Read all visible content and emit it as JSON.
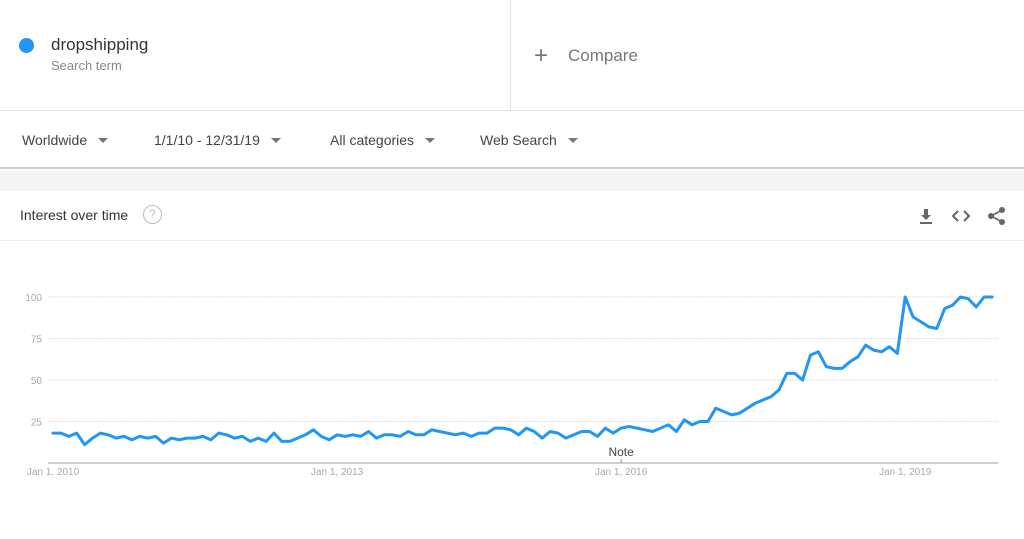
{
  "search_term": {
    "name": "dropshipping",
    "subtitle": "Search term",
    "color": "#2196f3"
  },
  "compare": {
    "icon": "plus-icon",
    "label": "Compare"
  },
  "filters": [
    {
      "label": "Worldwide"
    },
    {
      "label": "1/1/10 - 12/31/19"
    },
    {
      "label": "All categories"
    },
    {
      "label": "Web Search"
    }
  ],
  "card": {
    "title": "Interest over time",
    "help_icon": "?",
    "tools": [
      "download-icon",
      "embed-icon",
      "share-icon"
    ]
  },
  "chart_data": {
    "type": "line",
    "title": "Interest over time",
    "xlabel": "",
    "ylabel": "",
    "ylim": [
      0,
      100
    ],
    "y_ticks": [
      25,
      50,
      75,
      100
    ],
    "x_tick_labels": [
      "Jan 1, 2010",
      "Jan 1, 2013",
      "Jan 1, 2016",
      "Jan 1, 2019"
    ],
    "x_tick_indices": [
      0,
      36,
      72,
      108
    ],
    "grid": true,
    "legend": "none",
    "annotations": [
      {
        "label": "Note",
        "index": 72
      }
    ],
    "series": [
      {
        "name": "dropshipping",
        "color": "#2196f3",
        "x_start": "2010-01",
        "x_step": "month",
        "values": [
          18,
          18,
          16,
          18,
          11,
          15,
          18,
          17,
          15,
          16,
          14,
          16,
          15,
          16,
          12,
          15,
          14,
          15,
          15,
          16,
          14,
          18,
          17,
          15,
          16,
          13,
          15,
          13,
          18,
          13,
          13,
          15,
          17,
          20,
          16,
          14,
          17,
          16,
          17,
          16,
          19,
          15,
          17,
          17,
          16,
          19,
          17,
          17,
          20,
          19,
          18,
          17,
          18,
          16,
          18,
          18,
          21,
          21,
          20,
          17,
          21,
          19,
          15,
          19,
          18,
          15,
          17,
          19,
          19,
          16,
          21,
          18,
          21,
          22,
          21,
          20,
          19,
          21,
          23,
          19,
          26,
          23,
          25,
          25,
          33,
          31,
          29,
          30,
          33,
          36,
          38,
          40,
          44,
          54,
          54,
          50,
          65,
          67,
          58,
          57,
          57,
          61,
          64,
          71,
          68,
          67,
          70,
          66,
          100,
          88,
          85,
          82,
          81,
          93,
          95,
          100,
          99,
          94,
          100,
          100
        ]
      }
    ]
  }
}
